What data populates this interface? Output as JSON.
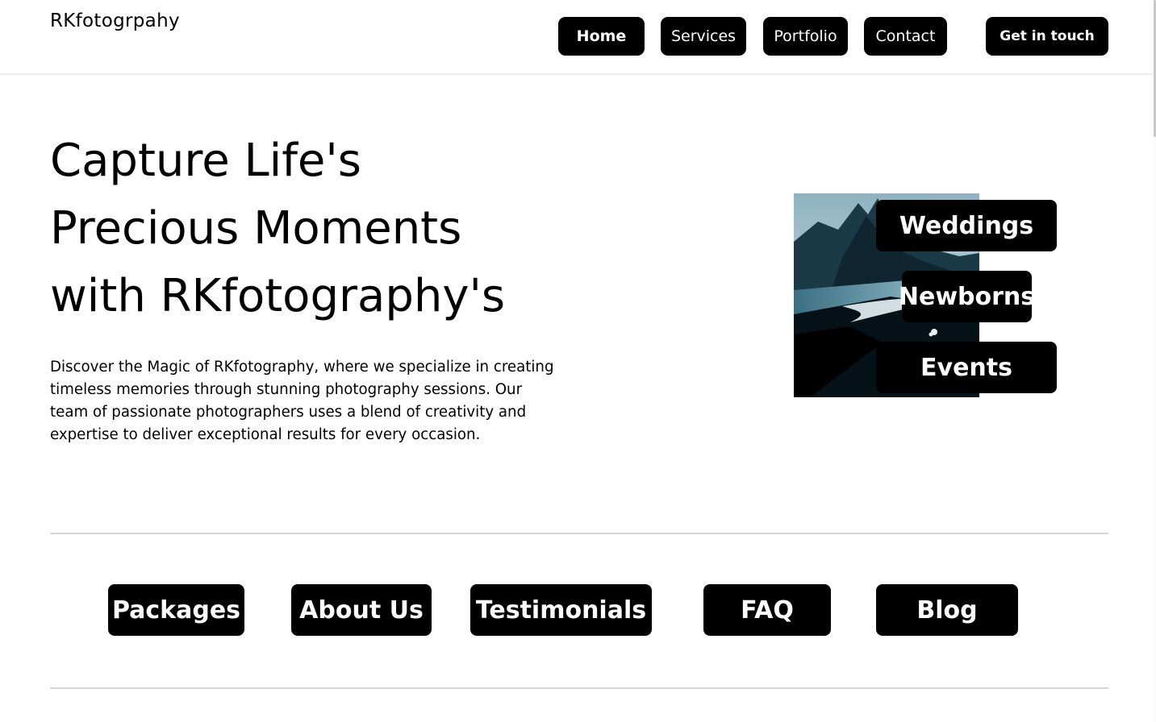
{
  "header": {
    "logo": "RKfotogrpahy",
    "nav": [
      {
        "label": "Home"
      },
      {
        "label": "Services"
      },
      {
        "label": "Portfolio"
      },
      {
        "label": "Contact"
      }
    ],
    "cta_label": "Get in touch"
  },
  "hero": {
    "title_lines": [
      "Capture Life's",
      "Precious Moments",
      "with RKfotography's"
    ],
    "description": "Discover the Magic of RKfotography, where we specialize in creating timeless memories through stunning photography sessions. Our team of passionate photographers uses a blend of creativity and expertise to deliver exceptional results for every occasion.",
    "categories": [
      {
        "label": "Weddings"
      },
      {
        "label": "Newborns"
      },
      {
        "label": "Events"
      }
    ]
  },
  "sections": [
    {
      "label": "Packages"
    },
    {
      "label": "About Us"
    },
    {
      "label": "Testimonials"
    },
    {
      "label": "FAQ"
    },
    {
      "label": "Blog"
    }
  ],
  "colors": {
    "button_bg": "#000000",
    "button_text": "#ffffff",
    "divider": "#d6d6d6"
  }
}
